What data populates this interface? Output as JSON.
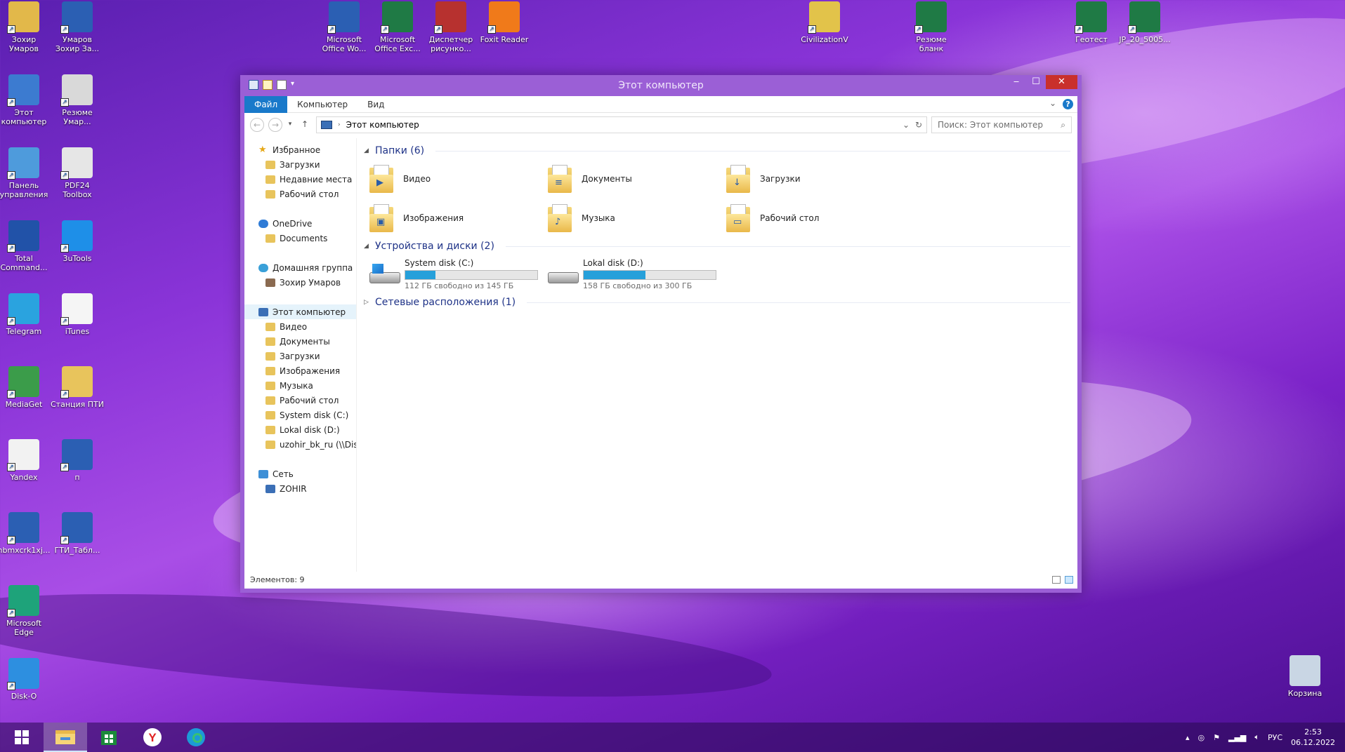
{
  "desktop": {
    "icons": [
      {
        "label": "Зохир Умаров",
        "color": "#e2b84a"
      },
      {
        "label": "Умаров Зохир За...",
        "color": "#2b5fb3"
      },
      {
        "label": "Этот компьютер",
        "color": "#3c7bd0"
      },
      {
        "label": "Резюме Умар...",
        "color": "#d9d9d9"
      },
      {
        "label": "Панель управления",
        "color": "#4e9bdc"
      },
      {
        "label": "PDF24 Toolbox",
        "color": "#e6e6e6"
      },
      {
        "label": "Total Command...",
        "color": "#2152a8"
      },
      {
        "label": "3uTools",
        "color": "#1e8fe8"
      },
      {
        "label": "Telegram",
        "color": "#2aa3df"
      },
      {
        "label": "iTunes",
        "color": "#f5f5f5"
      },
      {
        "label": "MediaGet",
        "color": "#3b9c4a"
      },
      {
        "label": "Станция ПТИ",
        "color": "#e8c45c"
      },
      {
        "label": "Yandex",
        "color": "#f2f2f2"
      },
      {
        "label": "п",
        "color": "#2b5fb3"
      },
      {
        "label": "nbmxcrk1xj...",
        "color": "#2b5fb3"
      },
      {
        "label": "ГТИ_Табл...",
        "color": "#2b5fb3"
      },
      {
        "label": "Microsoft Edge",
        "color": "#1ea37a"
      },
      {
        "label": "Disk-O",
        "color": "#2d8fe0"
      },
      {
        "label": "Microsoft Office Wo...",
        "color": "#2b5fb3"
      },
      {
        "label": "Microsoft Office Exc...",
        "color": "#1f7a45"
      },
      {
        "label": "Диспетчер рисунко...",
        "color": "#b7312f"
      },
      {
        "label": "Foxit Reader",
        "color": "#f07a1a"
      },
      {
        "label": "CivilizationV",
        "color": "#e2c34a"
      },
      {
        "label": "Резюме бланк",
        "color": "#1f7a45"
      },
      {
        "label": "Геотест",
        "color": "#1f7a45"
      },
      {
        "label": "JP_20_5005...",
        "color": "#1f7a45"
      },
      {
        "label": "Корзина",
        "color": "#c9d6e4"
      }
    ]
  },
  "window": {
    "title": "Этот компьютер",
    "ribbon": {
      "tabs": [
        "Файл",
        "Компьютер",
        "Вид"
      ],
      "help": "?"
    },
    "address": {
      "path": "Этот компьютер"
    },
    "search": {
      "placeholder": "Поиск: Этот компьютер"
    },
    "nav": {
      "favorites": "Избранное",
      "fav_items": [
        "Загрузки",
        "Недавние места",
        "Рабочий стол"
      ],
      "onedrive": "OneDrive",
      "onedrive_items": [
        "Documents"
      ],
      "homegroup": "Домашняя группа",
      "homegroup_items": [
        "Зохир Умаров"
      ],
      "thispc": "Этот компьютер",
      "thispc_items": [
        "Видео",
        "Документы",
        "Загрузки",
        "Изображения",
        "Музыка",
        "Рабочий стол",
        "System disk (C:)",
        "Lokal disk (D:)",
        "uzohir_bk_ru (\\\\Disk"
      ],
      "network": "Сеть",
      "network_items": [
        "ZOHIR"
      ]
    },
    "groups": {
      "folders": "Папки (6)",
      "devices": "Устройства и диски (2)",
      "network": "Сетевые расположения (1)"
    },
    "folders": [
      "Видео",
      "Документы",
      "Загрузки",
      "Изображения",
      "Музыка",
      "Рабочий стол"
    ],
    "drives": [
      {
        "name": "System disk (C:)",
        "free": "112 ГБ свободно из 145 ГБ",
        "used_fraction": 0.23
      },
      {
        "name": "Lokal disk (D:)",
        "free": "158 ГБ свободно из 300 ГБ",
        "used_fraction": 0.47
      }
    ],
    "status": "Элементов: 9"
  },
  "taskbar": {
    "lang": "РУС",
    "time": "2:53",
    "date": "06.12.2022"
  }
}
